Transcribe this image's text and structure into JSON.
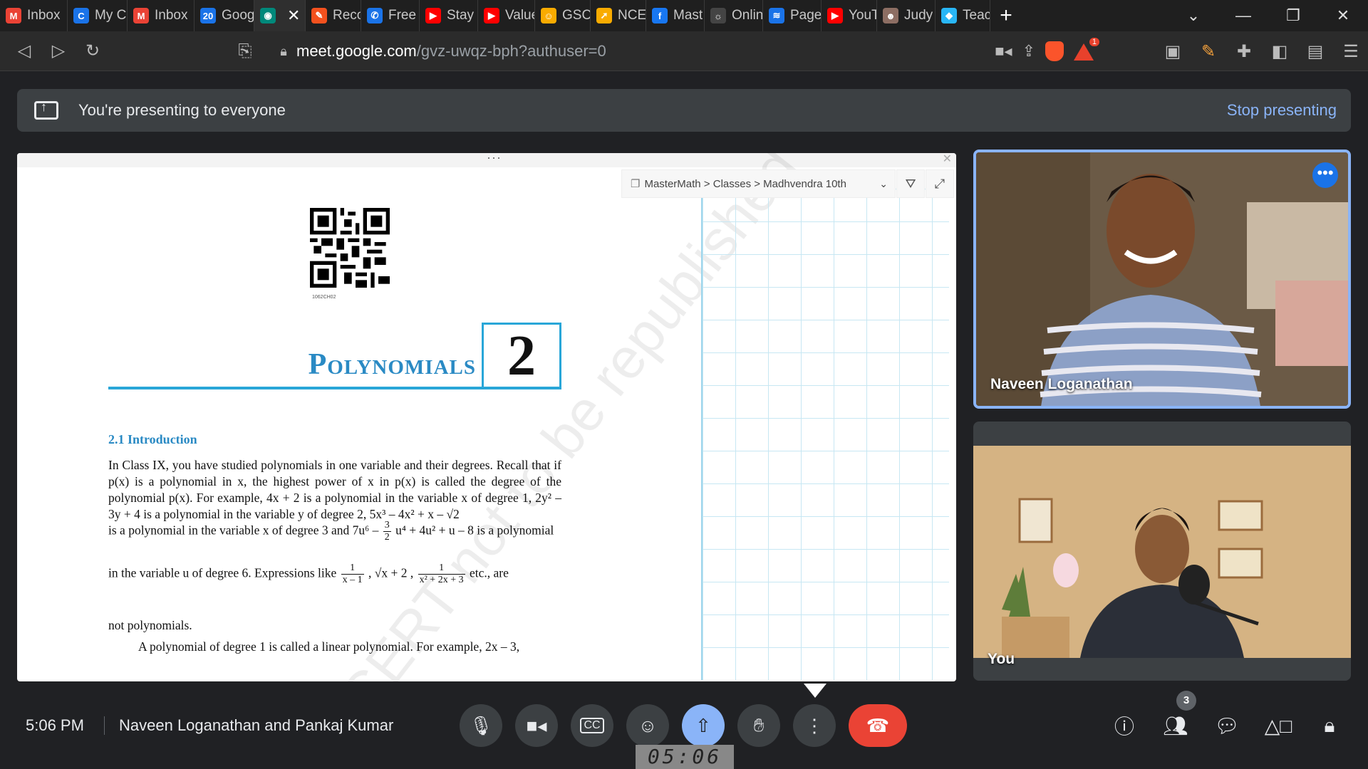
{
  "tabs": [
    {
      "label": "Inbox",
      "icon": "gmail-icon",
      "color": "#ea4335",
      "glyph": "M"
    },
    {
      "label": "My C",
      "icon": "chrome-icon",
      "color": "#1a73e8",
      "glyph": "C"
    },
    {
      "label": "Inbox",
      "icon": "gmail-icon",
      "color": "#ea4335",
      "glyph": "M"
    },
    {
      "label": "Goog",
      "icon": "calendar-icon",
      "color": "#1a73e8",
      "glyph": "20"
    },
    {
      "label": "",
      "icon": "meet-icon",
      "color": "#00897b",
      "glyph": "◉",
      "active": true
    },
    {
      "label": "Reco",
      "icon": "record-icon",
      "color": "#f4511e",
      "glyph": "✎"
    },
    {
      "label": "Free",
      "icon": "phone-icon",
      "color": "#1a73e8",
      "glyph": "✆"
    },
    {
      "label": "Stay",
      "icon": "youtube-icon",
      "color": "#ff0000",
      "glyph": "▶"
    },
    {
      "label": "Value",
      "icon": "youtube-icon",
      "color": "#ff0000",
      "glyph": "▶"
    },
    {
      "label": "GSC",
      "icon": "smiley-icon",
      "color": "#f9ab00",
      "glyph": "☺"
    },
    {
      "label": "NCEI",
      "icon": "rocket-icon",
      "color": "#f9ab00",
      "glyph": "➚"
    },
    {
      "label": "Mast",
      "icon": "facebook-icon",
      "color": "#1877f2",
      "glyph": "f"
    },
    {
      "label": "Onlin",
      "icon": "bulb-icon",
      "color": "#444444",
      "glyph": "☼"
    },
    {
      "label": "Page",
      "icon": "wifi-icon",
      "color": "#1a73e8",
      "glyph": "≋"
    },
    {
      "label": "YouT",
      "icon": "youtube-icon",
      "color": "#ff0000",
      "glyph": "▶"
    },
    {
      "label": "Judy",
      "icon": "avatar-icon",
      "color": "#8d6e63",
      "glyph": "☻"
    },
    {
      "label": "Teacl",
      "icon": "teach-icon",
      "color": "#29b6f6",
      "glyph": "◆"
    }
  ],
  "address": {
    "host": "meet.google.com",
    "path": "/gvz-uwqz-bph?authuser=0"
  },
  "brave_badge": "1",
  "banner": {
    "message": "You're presenting to everyone",
    "stop_label": "Stop presenting"
  },
  "mastermath": {
    "breadcrumb": "MasterMath > Classes > Madhvendra 10th"
  },
  "document": {
    "qr_caption": "1062CH02",
    "chapter_title": "Polynomials",
    "chapter_number": "2",
    "section_heading": "2.1  Introduction",
    "p1": "In Class IX, you have studied polynomials in one variable and their degrees. Recall that if p(x) is a polynomial in x, the highest power of x in p(x) is called the degree of the polynomial p(x). For example, 4x + 2 is a polynomial in the variable x of degree 1, 2y² – 3y + 4 is a polynomial in the variable y of degree 2, 5x³ – 4x² + x – √2",
    "p2_a": "is a polynomial in the variable x of degree 3 and 7u⁶ –",
    "p2_frac_num": "3",
    "p2_frac_den": "2",
    "p2_b": "u⁴ + 4u² + u – 8 is a polynomial",
    "p3_a": "in the variable u of degree 6. Expressions like",
    "p3_f1_num": "1",
    "p3_f1_den": "x – 1",
    "p3_mid": ", √x + 2 ,",
    "p3_f2_num": "1",
    "p3_f2_den": "x² + 2x + 3",
    "p3_b": "etc., are",
    "p4": "not polynomials.",
    "p5": "A polynomial of degree 1 is called a linear polynomial. For example, 2x – 3,",
    "watermark": "© NCERT  not to be republished"
  },
  "participants": [
    {
      "name": "Naveen Loganathan"
    },
    {
      "name": "You"
    }
  ],
  "bottom": {
    "time": "5:06 PM",
    "meeting_title": "Naveen Loganathan and Pankaj Kumar",
    "participant_count": "3",
    "timer": "05:06"
  }
}
